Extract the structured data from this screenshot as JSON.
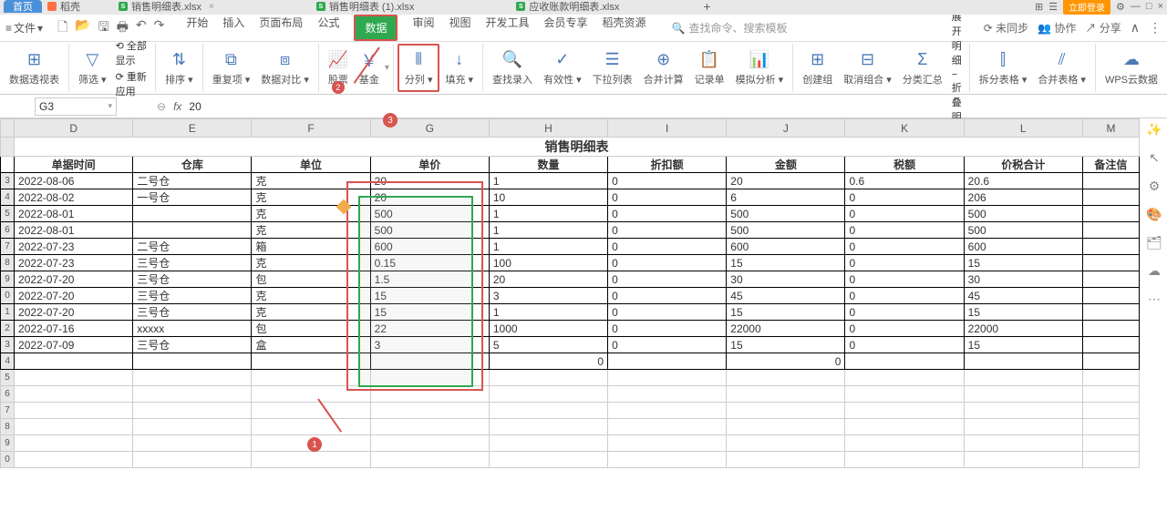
{
  "title_tabs": {
    "home": "首页",
    "daoke": "稻壳",
    "file1": "销售明细表.xlsx",
    "file2": "销售明细表 (1).xlsx",
    "file3": "应收账款明细表.xlsx",
    "add": "+"
  },
  "title_right": {
    "login": "立即登录",
    "min": "—",
    "max": "□",
    "close": "×"
  },
  "menu": {
    "file": "文件",
    "tabs": [
      "开始",
      "插入",
      "页面布局",
      "公式",
      "数据",
      "审阅",
      "视图",
      "开发工具",
      "会员专享",
      "稻壳资源"
    ],
    "search_placeholder": "查找命令、搜索模板"
  },
  "menu_right": {
    "unsync": "未同步",
    "coop": "协作",
    "share": "分享"
  },
  "toolbar": {
    "pivot": "数据透视表",
    "filter": "筛选",
    "show_all": "全部显示",
    "reapply": "重新应用",
    "sort": "排序",
    "dup": "重复项",
    "compare": "数据对比",
    "stock": "股票",
    "fund": "基金",
    "split": "分列",
    "fill": "填充",
    "find": "查找录入",
    "validate": "有效性",
    "dropdown": "下拉列表",
    "consolidate": "合并计算",
    "record": "记录单",
    "simulate": "模拟分析",
    "group": "创建组",
    "ungroup": "取消组合",
    "subtotal": "分类汇总",
    "show_detail": "展开明细",
    "hide_detail": "折叠明细",
    "split_table": "拆分表格",
    "merge_table": "合并表格",
    "wps_cloud": "WPS云数据"
  },
  "formula": {
    "cell_ref": "G3",
    "fx": "fx",
    "value": "20"
  },
  "grid": {
    "col_headers": [
      "D",
      "E",
      "F",
      "G",
      "H",
      "I",
      "J",
      "K",
      "L",
      "M"
    ],
    "title": "销售明细表",
    "headers": [
      "单据时间",
      "仓库",
      "单位",
      "单价",
      "数量",
      "折扣额",
      "金额",
      "税额",
      "价税合计",
      "备注信"
    ],
    "rows": [
      {
        "date": "2022-08-06",
        "wh": "二号仓",
        "unit": "克",
        "price": "20",
        "qty": "1",
        "disc": "0",
        "amt": "20",
        "tax": "0.6",
        "total": "20.6"
      },
      {
        "date": "2022-08-02",
        "wh": "一号仓",
        "unit": "克",
        "price": "20",
        "qty": "10",
        "disc": "0",
        "amt": "6",
        "tax": "0",
        "total": "206"
      },
      {
        "date": "2022-08-01",
        "wh": "",
        "unit": "克",
        "price": "500",
        "qty": "1",
        "disc": "0",
        "amt": "500",
        "tax": "0",
        "total": "500"
      },
      {
        "date": "2022-08-01",
        "wh": "",
        "unit": "克",
        "price": "500",
        "qty": "1",
        "disc": "0",
        "amt": "500",
        "tax": "0",
        "total": "500"
      },
      {
        "date": "2022-07-23",
        "wh": "二号仓",
        "unit": "箱",
        "price": "600",
        "qty": "1",
        "disc": "0",
        "amt": "600",
        "tax": "0",
        "total": "600"
      },
      {
        "date": "2022-07-23",
        "wh": "三号仓",
        "unit": "克",
        "price": "0.15",
        "qty": "100",
        "disc": "0",
        "amt": "15",
        "tax": "0",
        "total": "15"
      },
      {
        "date": "2022-07-20",
        "wh": "三号仓",
        "unit": "包",
        "price": "1.5",
        "qty": "20",
        "disc": "0",
        "amt": "30",
        "tax": "0",
        "total": "30"
      },
      {
        "date": "2022-07-20",
        "wh": "三号仓",
        "unit": "克",
        "price": "15",
        "qty": "3",
        "disc": "0",
        "amt": "45",
        "tax": "0",
        "total": "45"
      },
      {
        "date": "2022-07-20",
        "wh": "三号仓",
        "unit": "克",
        "price": "15",
        "qty": "1",
        "disc": "0",
        "amt": "15",
        "tax": "0",
        "total": "15"
      },
      {
        "date": "2022-07-16",
        "wh": "xxxxx",
        "unit": "包",
        "price": "22",
        "qty": "1000",
        "disc": "0",
        "amt": "22000",
        "tax": "0",
        "total": "22000"
      },
      {
        "date": "2022-07-09",
        "wh": "三号仓",
        "unit": "盒",
        "price": "3",
        "qty": "5",
        "disc": "0",
        "amt": "15",
        "tax": "0",
        "total": "15"
      }
    ],
    "sum_row": {
      "qty": "0",
      "amt": "0"
    }
  },
  "annotations": {
    "n1": "1",
    "n2": "2",
    "n3": "3"
  }
}
